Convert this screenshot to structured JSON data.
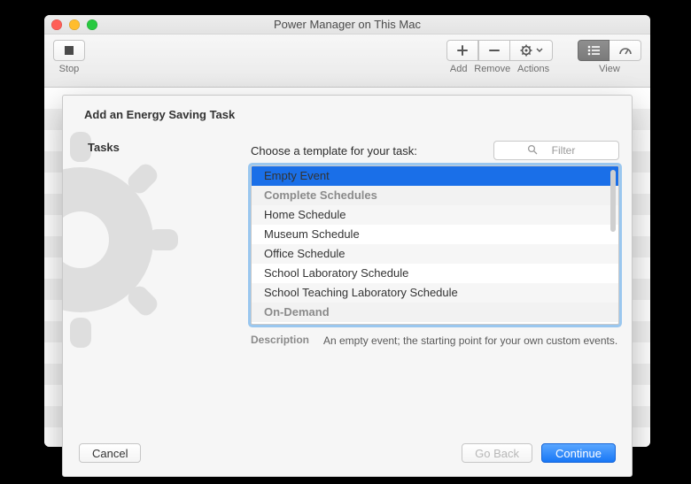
{
  "window": {
    "title": "Power Manager on This Mac"
  },
  "toolbar": {
    "stop_label": "Stop",
    "add_label": "Add",
    "remove_label": "Remove",
    "actions_label": "Actions",
    "view_label": "View"
  },
  "sheet": {
    "title": "Add an Energy Saving Task",
    "tasks_label": "Tasks",
    "choose_label": "Choose a template for your task:",
    "filter_placeholder": "Filter",
    "description_label": "Description",
    "description_text": "An empty event; the starting point for your own custom events.",
    "list": [
      {
        "type": "item",
        "label": "Empty Event",
        "selected": true
      },
      {
        "type": "header",
        "label": "Complete Schedules"
      },
      {
        "type": "item",
        "label": "Home Schedule"
      },
      {
        "type": "item",
        "label": "Museum Schedule"
      },
      {
        "type": "item",
        "label": "Office Schedule"
      },
      {
        "type": "item",
        "label": "School Laboratory Schedule"
      },
      {
        "type": "item",
        "label": "School Teaching Laboratory Schedule"
      },
      {
        "type": "header",
        "label": "On-Demand"
      }
    ],
    "buttons": {
      "cancel": "Cancel",
      "go_back": "Go Back",
      "continue": "Continue"
    }
  }
}
